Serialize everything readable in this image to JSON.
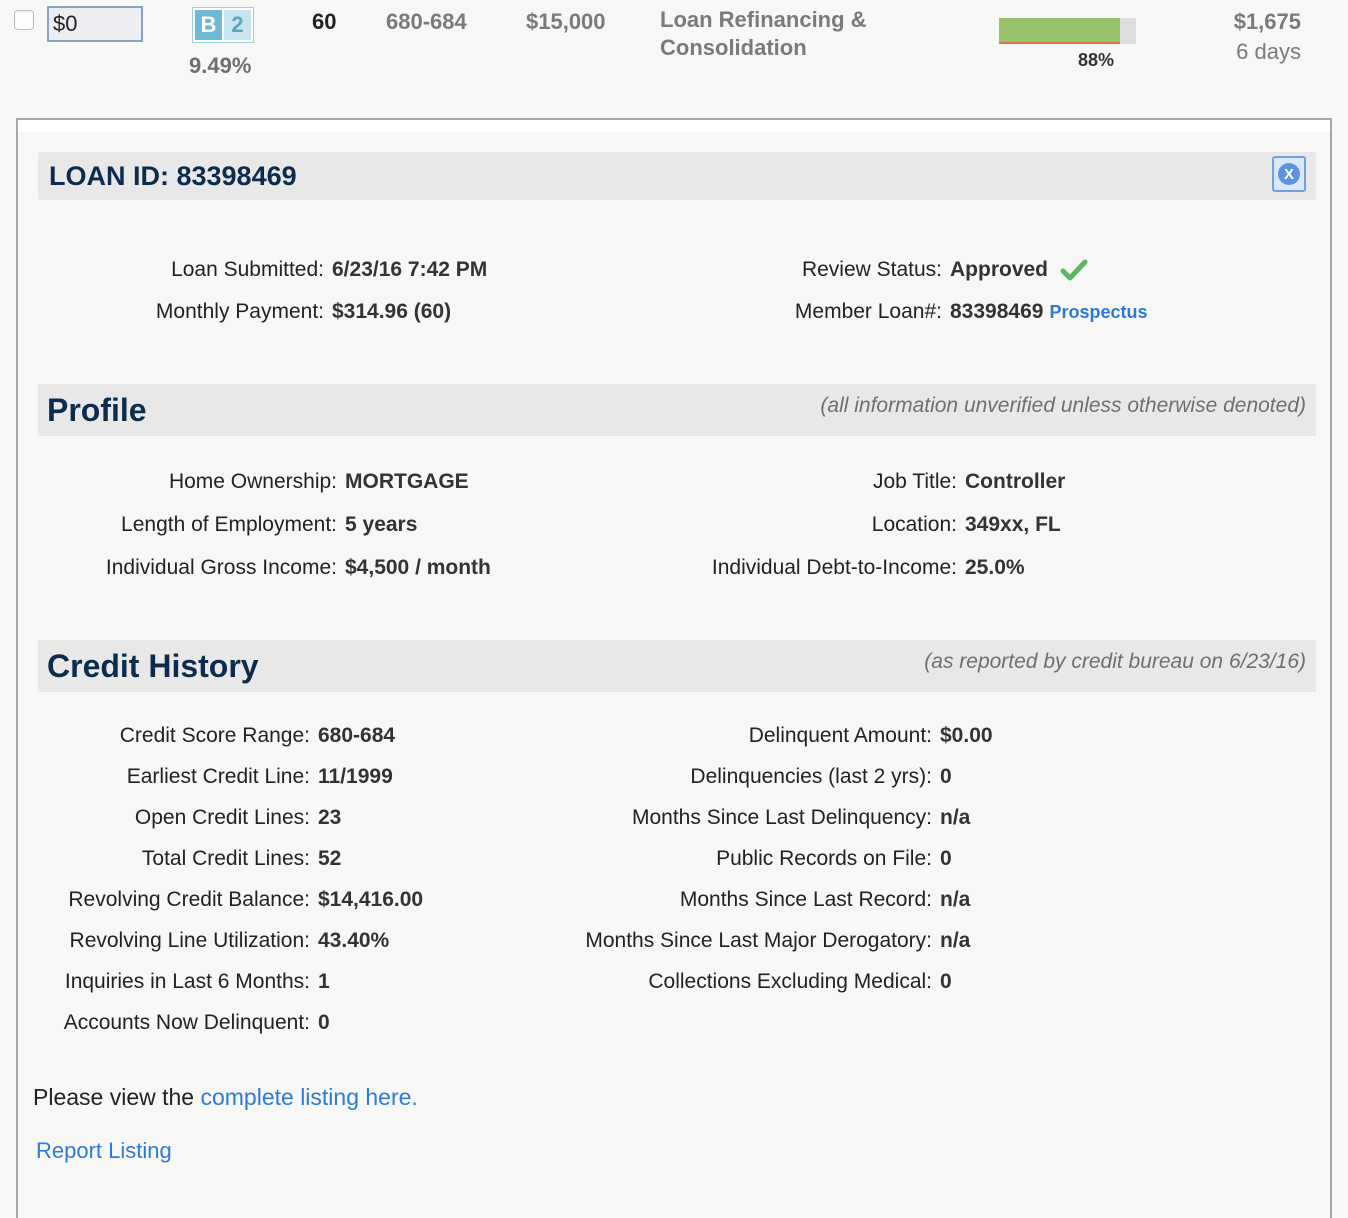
{
  "summary": {
    "invest_amount": "$0",
    "grade_letter": "B",
    "grade_sub": "2",
    "interest_rate": "9.49%",
    "term": "60",
    "fico": "680-684",
    "amount": "$15,000",
    "purpose": "Loan Refinancing & Consolidation",
    "funded_fraction": 0.88,
    "funded_pct": "88%",
    "remaining_amount": "$1,675",
    "remaining_time": "6 days"
  },
  "loan": {
    "id_label": "LOAN ID: 83398469",
    "close_glyph": "X",
    "left": [
      {
        "label": "Loan Submitted:",
        "value": "6/23/16 7:42 PM"
      },
      {
        "label": "Monthly Payment:",
        "value": "$314.96 (60)"
      }
    ],
    "review_status_label": "Review Status:",
    "review_status_value": "Approved",
    "member_loan_label": "Member Loan#:",
    "member_loan_value": "83398469",
    "prospectus_link": "Prospectus"
  },
  "profile": {
    "title": "Profile",
    "note": "(all information unverified unless otherwise denoted)",
    "left": [
      {
        "label": "Home Ownership:",
        "value": "MORTGAGE"
      },
      {
        "label": "Length of Employment:",
        "value": "5 years"
      },
      {
        "label": "Individual Gross Income:",
        "value": "$4,500 / month"
      }
    ],
    "right": [
      {
        "label": "Job Title:",
        "value": "Controller"
      },
      {
        "label": "Location:",
        "value": "349xx, FL"
      },
      {
        "label": "Individual Debt-to-Income:",
        "value": "25.0%"
      }
    ]
  },
  "credit": {
    "title": "Credit History",
    "note": "(as reported by credit bureau on 6/23/16)",
    "left": [
      {
        "label": "Credit Score Range:",
        "value": "680-684"
      },
      {
        "label": "Earliest Credit Line:",
        "value": "11/1999"
      },
      {
        "label": "Open Credit Lines:",
        "value": "23"
      },
      {
        "label": "Total Credit Lines:",
        "value": "52"
      },
      {
        "label": "Revolving Credit Balance:",
        "value": "$14,416.00"
      },
      {
        "label": "Revolving Line Utilization:",
        "value": "43.40%"
      },
      {
        "label": "Inquiries in Last 6 Months:",
        "value": "1"
      },
      {
        "label": "Accounts Now Delinquent:",
        "value": "0"
      }
    ],
    "right": [
      {
        "label": "Delinquent Amount:",
        "value": "$0.00"
      },
      {
        "label": "Delinquencies (last 2 yrs):",
        "value": "0"
      },
      {
        "label": "Months Since Last Delinquency:",
        "value": "n/a"
      },
      {
        "label": "Public Records on File:",
        "value": "0"
      },
      {
        "label": "Months Since Last Record:",
        "value": "n/a"
      },
      {
        "label": "Months Since Last Major Derogatory:",
        "value": "n/a"
      },
      {
        "label": "Collections Excluding Medical:",
        "value": "0"
      }
    ]
  },
  "footer": {
    "view_text": "Please view the ",
    "view_link": "complete listing here.",
    "report_link": "Report Listing"
  },
  "colors": {
    "accent_link": "#2d7bd6",
    "heading_navy": "#0c2c4e",
    "funding_fill": "#99c36a",
    "approved_green": "#5cb85c"
  }
}
